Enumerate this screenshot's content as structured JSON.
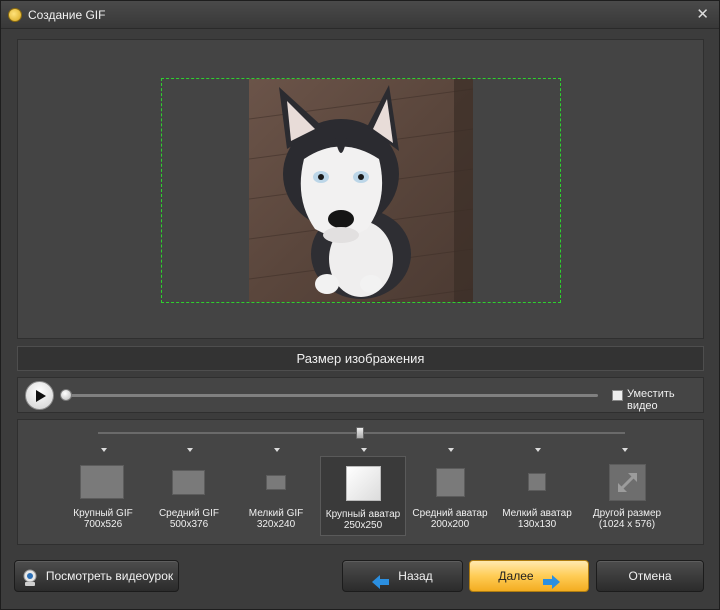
{
  "window": {
    "title": "Создание GIF",
    "close_glyph": "✕"
  },
  "section": {
    "header": "Размер изображения"
  },
  "player": {
    "fit_video_label": "Уместить видео",
    "fit_video_checked": false
  },
  "sizes": [
    {
      "name": "Крупный GIF",
      "dim": "700x526",
      "selected": false
    },
    {
      "name": "Средний GIF",
      "dim": "500x376",
      "selected": false
    },
    {
      "name": "Мелкий GIF",
      "dim": "320x240",
      "selected": false
    },
    {
      "name": "Крупный аватар",
      "dim": "250x250",
      "selected": true
    },
    {
      "name": "Средний аватар",
      "dim": "200x200",
      "selected": false
    },
    {
      "name": "Мелкий аватар",
      "dim": "130x130",
      "selected": false
    },
    {
      "name": "Другой размер",
      "dim": "(1024 x 576)",
      "selected": false
    }
  ],
  "buttons": {
    "tutorial": "Посмотреть видеоурок",
    "back": "Назад",
    "next": "Далее",
    "cancel": "Отмена"
  },
  "colors": {
    "crop_frame": "#2ed12e",
    "accent_button": "#ffcc55",
    "arrow_blue": "#2b8fe0"
  },
  "icons": {
    "play": "play-icon",
    "back": "arrow-left-icon",
    "next": "arrow-right-icon",
    "tutorial": "webcam-icon",
    "custom_size": "expand-icon"
  }
}
